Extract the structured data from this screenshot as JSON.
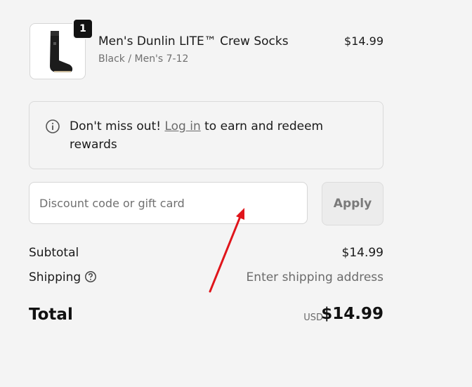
{
  "product": {
    "name": "Men's Dunlin LITE™ Crew Socks",
    "variant": "Black / Men's 7-12",
    "price": "$14.99",
    "quantity": "1",
    "image_icon": "sock-icon"
  },
  "notice": {
    "icon": "info-icon",
    "text_before": "Don't miss out! ",
    "link": "Log in",
    "text_after": " to earn and redeem rewards"
  },
  "discount": {
    "placeholder": "Discount code or gift card",
    "value": "",
    "apply_label": "Apply"
  },
  "totals": {
    "subtotal_label": "Subtotal",
    "subtotal_value": "$14.99",
    "shipping_label": "Shipping",
    "shipping_value": "Enter shipping address",
    "total_label": "Total",
    "currency": "USD",
    "total_value": "$14.99"
  },
  "colors": {
    "background": "#f4f4f4",
    "annotation_arrow": "#e0151b"
  }
}
